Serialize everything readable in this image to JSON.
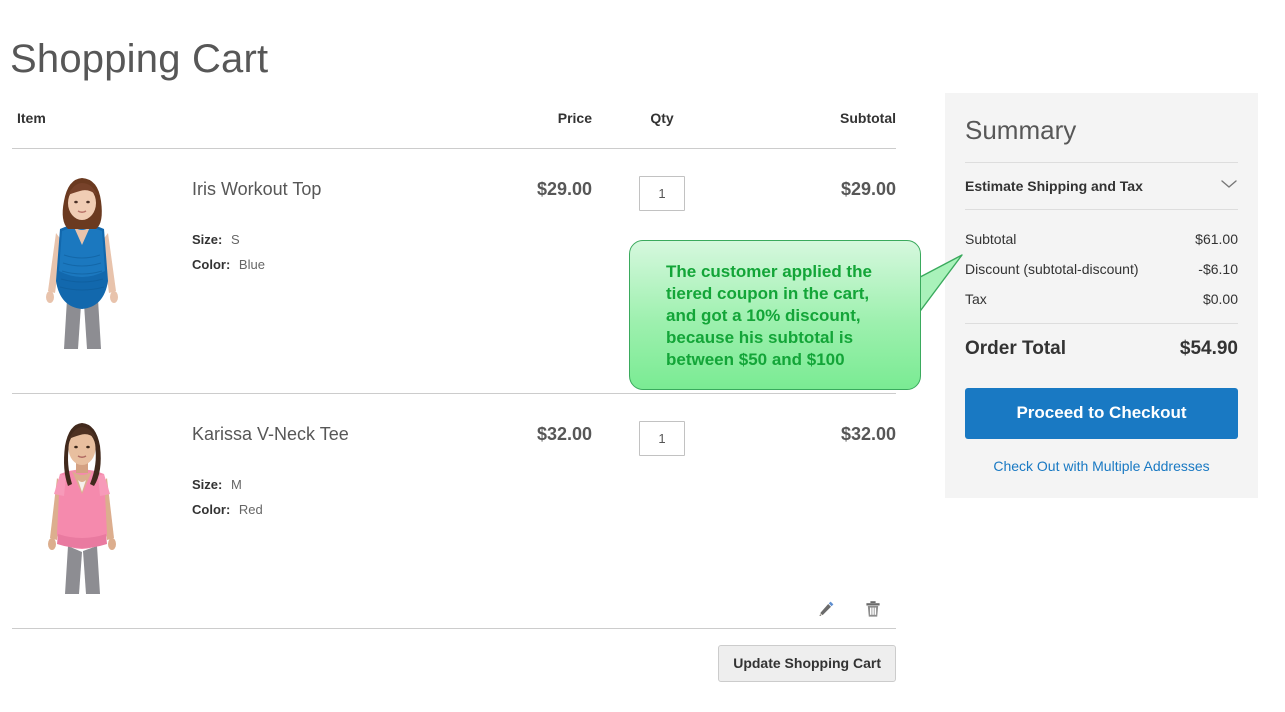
{
  "page": {
    "title": "Shopping Cart"
  },
  "cart": {
    "columns": {
      "item": "Item",
      "price": "Price",
      "qty": "Qty",
      "subtotal": "Subtotal"
    },
    "items": [
      {
        "name": "Iris Workout Top",
        "size_label": "Size:",
        "size_value": "S",
        "color_label": "Color:",
        "color_value": "Blue",
        "price": "$29.00",
        "qty": "1",
        "subtotal": "$29.00"
      },
      {
        "name": "Karissa V-Neck Tee",
        "size_label": "Size:",
        "size_value": "M",
        "color_label": "Color:",
        "color_value": "Red",
        "price": "$32.00",
        "qty": "1",
        "subtotal": "$32.00"
      }
    ],
    "actions": {
      "edit_icon": "pencil-icon",
      "delete_icon": "trash-icon",
      "update_label": "Update Shopping Cart"
    }
  },
  "summary": {
    "title": "Summary",
    "estimate_label": "Estimate Shipping and Tax",
    "estimate_icon": "chevron-down-icon",
    "lines": [
      {
        "label": "Subtotal",
        "value": "$61.00"
      },
      {
        "label": "Discount (subtotal-discount)",
        "value": "-$6.10"
      },
      {
        "label": "Tax",
        "value": "$0.00"
      }
    ],
    "order_total_label": "Order Total",
    "order_total_value": "$54.90",
    "checkout_label": "Proceed to Checkout",
    "multi_address_label": "Check Out with Multiple Addresses"
  },
  "annotation": {
    "text": "The customer applied the\ntiered coupon in the cart,\nand got a 10% discount,\nbecause his subtotal is\nbetween $50 and $100"
  },
  "colors": {
    "accent_blue": "#1979c3",
    "panel_bg": "#f4f4f4",
    "callout_green": "#13a538",
    "title_gray": "#575757"
  }
}
